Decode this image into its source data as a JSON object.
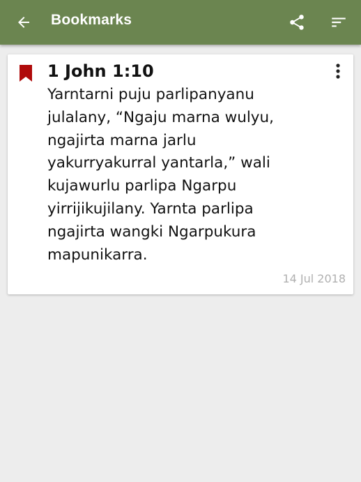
{
  "appbar": {
    "title": "Bookmarks",
    "background_color": "#6b8550",
    "back_icon": "arrow-back-icon",
    "share_icon": "share-icon",
    "sort_icon": "sort-icon"
  },
  "bookmarks": [
    {
      "reference": "1 John 1:10",
      "text": "Yarntarni puju parlipanyanu\njulalany, “Ngaju marna wulyu,\nngajirta marna jarlu\nyakurryakurral yantarla,” wali\nkujawurlu parlipa Ngarpu\nyirrijikujilany. Yarnta parlipa\nngajirta wangki Ngarpukura\nmapunikarra.",
      "date": "14 Jul 2018",
      "bookmark_icon": "bookmark-icon",
      "bookmark_color": "#b00b0b",
      "menu_icon": "more-vert-icon"
    }
  ]
}
